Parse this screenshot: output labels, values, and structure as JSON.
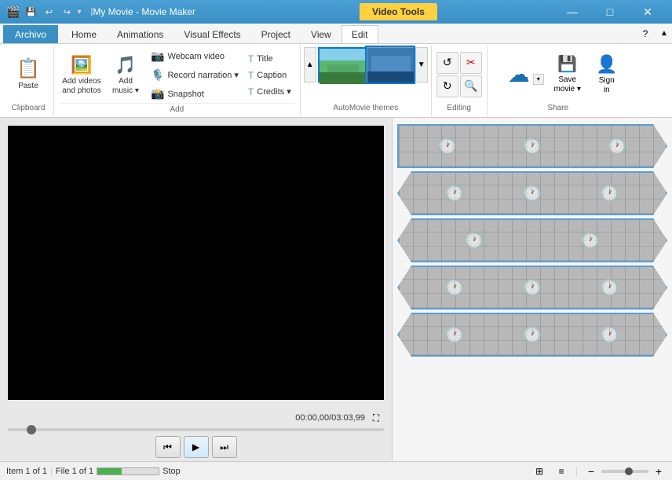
{
  "titleBar": {
    "appIcon": "🎬",
    "quickAccess": [
      "💾",
      "↩",
      "↪"
    ],
    "title": "My Movie - Movie Maker",
    "videoToolsTab": "Video Tools",
    "controls": [
      "—",
      "□",
      "✕"
    ]
  },
  "ribbonTabs": {
    "active": "Edit",
    "items": [
      "Archivo",
      "Home",
      "Animations",
      "Visual Effects",
      "Project",
      "View",
      "Edit"
    ]
  },
  "ribbon": {
    "groups": {
      "clipboard": {
        "label": "Clipboard",
        "paste": "Paste"
      },
      "add": {
        "label": "Add",
        "addVideos": "Add videos\nand photos",
        "addMusic": "Add\nmusic",
        "webcamVideo": "Webcam video",
        "recordNarration": "Record narration",
        "snapshot": "Snapshot",
        "title": "Title",
        "caption": "Caption",
        "credits": "Credits"
      },
      "autoMovieThemes": {
        "label": "AutoMovie themes"
      },
      "editing": {
        "label": "Editing"
      },
      "share": {
        "label": "Share",
        "saveMovie": "Save\nmovie",
        "signIn": "Sign\nin"
      }
    }
  },
  "videoPlayer": {
    "timeDisplay": "00:00,00/03:03,99",
    "controls": {
      "rewind": "⏮",
      "play": "▶",
      "stepForward": "⏭"
    }
  },
  "statusBar": {
    "item": "Item 1 of 1",
    "file": "File 1 of 1",
    "stop": "Stop"
  },
  "timeline": {
    "strips": [
      {
        "type": "first",
        "clocks": 3
      },
      {
        "type": "middle",
        "clocks": 3
      },
      {
        "type": "middle",
        "clocks": 2
      },
      {
        "type": "middle",
        "clocks": 3
      },
      {
        "type": "last",
        "clocks": 3
      }
    ]
  }
}
